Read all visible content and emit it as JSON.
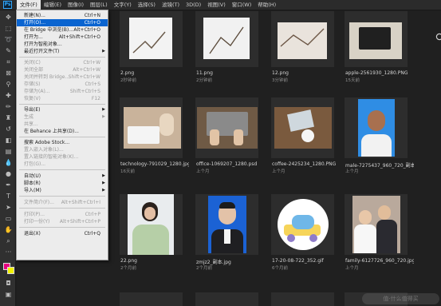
{
  "app": {
    "logo": "Ps"
  },
  "menubar": {
    "items": [
      "文件(F)",
      "编辑(E)",
      "图像(I)",
      "图层(L)",
      "文字(Y)",
      "选择(S)",
      "滤镜(T)",
      "3D(D)",
      "视图(V)",
      "窗口(W)",
      "帮助(H)"
    ]
  },
  "file_menu": {
    "items": [
      {
        "label": "新建(N)...",
        "shortcut": "Ctrl+N",
        "state": "normal"
      },
      {
        "label": "打开(O)...",
        "shortcut": "Ctrl+O",
        "state": "highlight"
      },
      {
        "label": "在 Bridge 中浏览(B)...",
        "shortcut": "Alt+Ctrl+O",
        "state": "normal"
      },
      {
        "label": "打开为...",
        "shortcut": "Alt+Shift+Ctrl+O",
        "state": "normal"
      },
      {
        "label": "打开为智能对象...",
        "shortcut": "",
        "state": "normal"
      },
      {
        "label": "最近打开文件(T)",
        "shortcut": "",
        "state": "normal",
        "submenu": "▶"
      },
      {
        "label": "关闭(C)",
        "shortcut": "Ctrl+W",
        "state": "disabled"
      },
      {
        "label": "关闭全部",
        "shortcut": "Alt+Ctrl+W",
        "state": "disabled"
      },
      {
        "label": "关闭并转到 Bridge...",
        "shortcut": "Shift+Ctrl+W",
        "state": "disabled"
      },
      {
        "label": "存储(S)",
        "shortcut": "Ctrl+S",
        "state": "disabled"
      },
      {
        "label": "存储为(A)...",
        "shortcut": "Shift+Ctrl+S",
        "state": "disabled"
      },
      {
        "label": "恢复(V)",
        "shortcut": "F12",
        "state": "disabled"
      },
      {
        "label": "导出(E)",
        "shortcut": "",
        "state": "normal",
        "submenu": "▶"
      },
      {
        "label": "生成",
        "shortcut": "",
        "state": "disabled",
        "submenu": "▶"
      },
      {
        "label": "共享...",
        "shortcut": "",
        "state": "disabled"
      },
      {
        "label": "在 Behance 上共享(D)...",
        "shortcut": "",
        "state": "normal"
      },
      {
        "label": "搜索 Adobe Stock...",
        "shortcut": "",
        "state": "normal"
      },
      {
        "label": "置入嵌入对象(L)...",
        "shortcut": "",
        "state": "disabled"
      },
      {
        "label": "置入链接的智能对象(K)...",
        "shortcut": "",
        "state": "disabled"
      },
      {
        "label": "打包(G)...",
        "shortcut": "",
        "state": "disabled"
      },
      {
        "label": "自动(U)",
        "shortcut": "",
        "state": "normal",
        "submenu": "▶"
      },
      {
        "label": "脚本(R)",
        "shortcut": "",
        "state": "normal",
        "submenu": "▶"
      },
      {
        "label": "导入(M)",
        "shortcut": "",
        "state": "normal",
        "submenu": "▶"
      },
      {
        "label": "文件简介(F)...",
        "shortcut": "Alt+Shift+Ctrl+I",
        "state": "disabled"
      },
      {
        "label": "打印(P)...",
        "shortcut": "Ctrl+P",
        "state": "disabled"
      },
      {
        "label": "打印一份(Y)",
        "shortcut": "Alt+Shift+Ctrl+P",
        "state": "disabled"
      },
      {
        "label": "退出(X)",
        "shortcut": "Ctrl+Q",
        "state": "normal"
      }
    ]
  },
  "files": [
    {
      "name": "2.png",
      "time": "2秒钟前"
    },
    {
      "name": "11.png",
      "time": "2分钟前"
    },
    {
      "name": "12.png",
      "time": "3分钟前"
    },
    {
      "name": "apple-2561930_1280.PNG",
      "time": "15天前"
    },
    {
      "name": "technology-791029_1280.jpg",
      "time": "16天前"
    },
    {
      "name": "office-1069207_1280.psd",
      "time": "上个月"
    },
    {
      "name": "coffee-2425234_1280.PNG",
      "time": "上个月"
    },
    {
      "name": "male-7275437_960_720_副本...",
      "time": "上个月"
    },
    {
      "name": "22.png",
      "time": "2个月前"
    },
    {
      "name": "zmjz2_副本.jpg",
      "time": "2个月前"
    },
    {
      "name": "17-20-08-722_352.gif",
      "time": "6个月前"
    },
    {
      "name": "family-6127726_960_720.jpg",
      "time": "上个月"
    }
  ],
  "watermark": "值·什么值得买",
  "colors": {
    "foreground": "#e6007e",
    "background": "#f2f200",
    "highlight": "#0a64d0"
  }
}
